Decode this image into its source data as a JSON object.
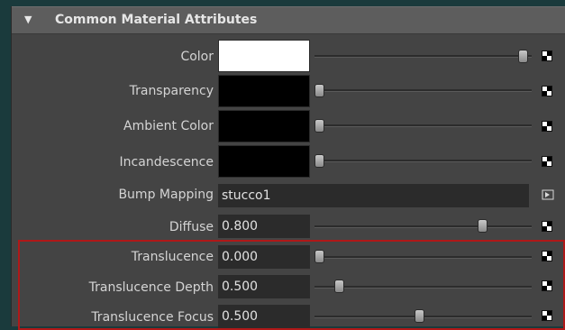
{
  "section": {
    "title": "Common Material Attributes",
    "expanded_icon": "triangle-down-icon"
  },
  "attributes": {
    "color": {
      "label": "Color",
      "swatch_color": "#ffffff",
      "slider_value": 1.0
    },
    "transparency": {
      "label": "Transparency",
      "swatch_color": "#000000",
      "slider_value": 0.0
    },
    "ambient_color": {
      "label": "Ambient Color",
      "swatch_color": "#000000",
      "slider_value": 0.0
    },
    "incandescence": {
      "label": "Incandescence",
      "swatch_color": "#000000",
      "slider_value": 0.0
    },
    "bump_mapping": {
      "label": "Bump Mapping",
      "value": "stucco1"
    },
    "diffuse": {
      "label": "Diffuse",
      "value": "0.800",
      "slider_value": 0.8
    },
    "translucence": {
      "label": "Translucence",
      "value": "0.000",
      "slider_value": 0.0
    },
    "translucence_depth": {
      "label": "Translucence Depth",
      "value": "0.500",
      "slider_value": 0.1
    },
    "translucence_focus": {
      "label": "Translucence Focus",
      "value": "0.500",
      "slider_value": 0.5
    }
  },
  "icons": {
    "map_button": "checker-map-icon",
    "bump_map_button": "input-connection-icon"
  },
  "colors": {
    "panel_bg": "#444444",
    "header_bg": "#5d5d5d",
    "field_bg": "#2b2b2b",
    "highlight": "#b01818"
  }
}
